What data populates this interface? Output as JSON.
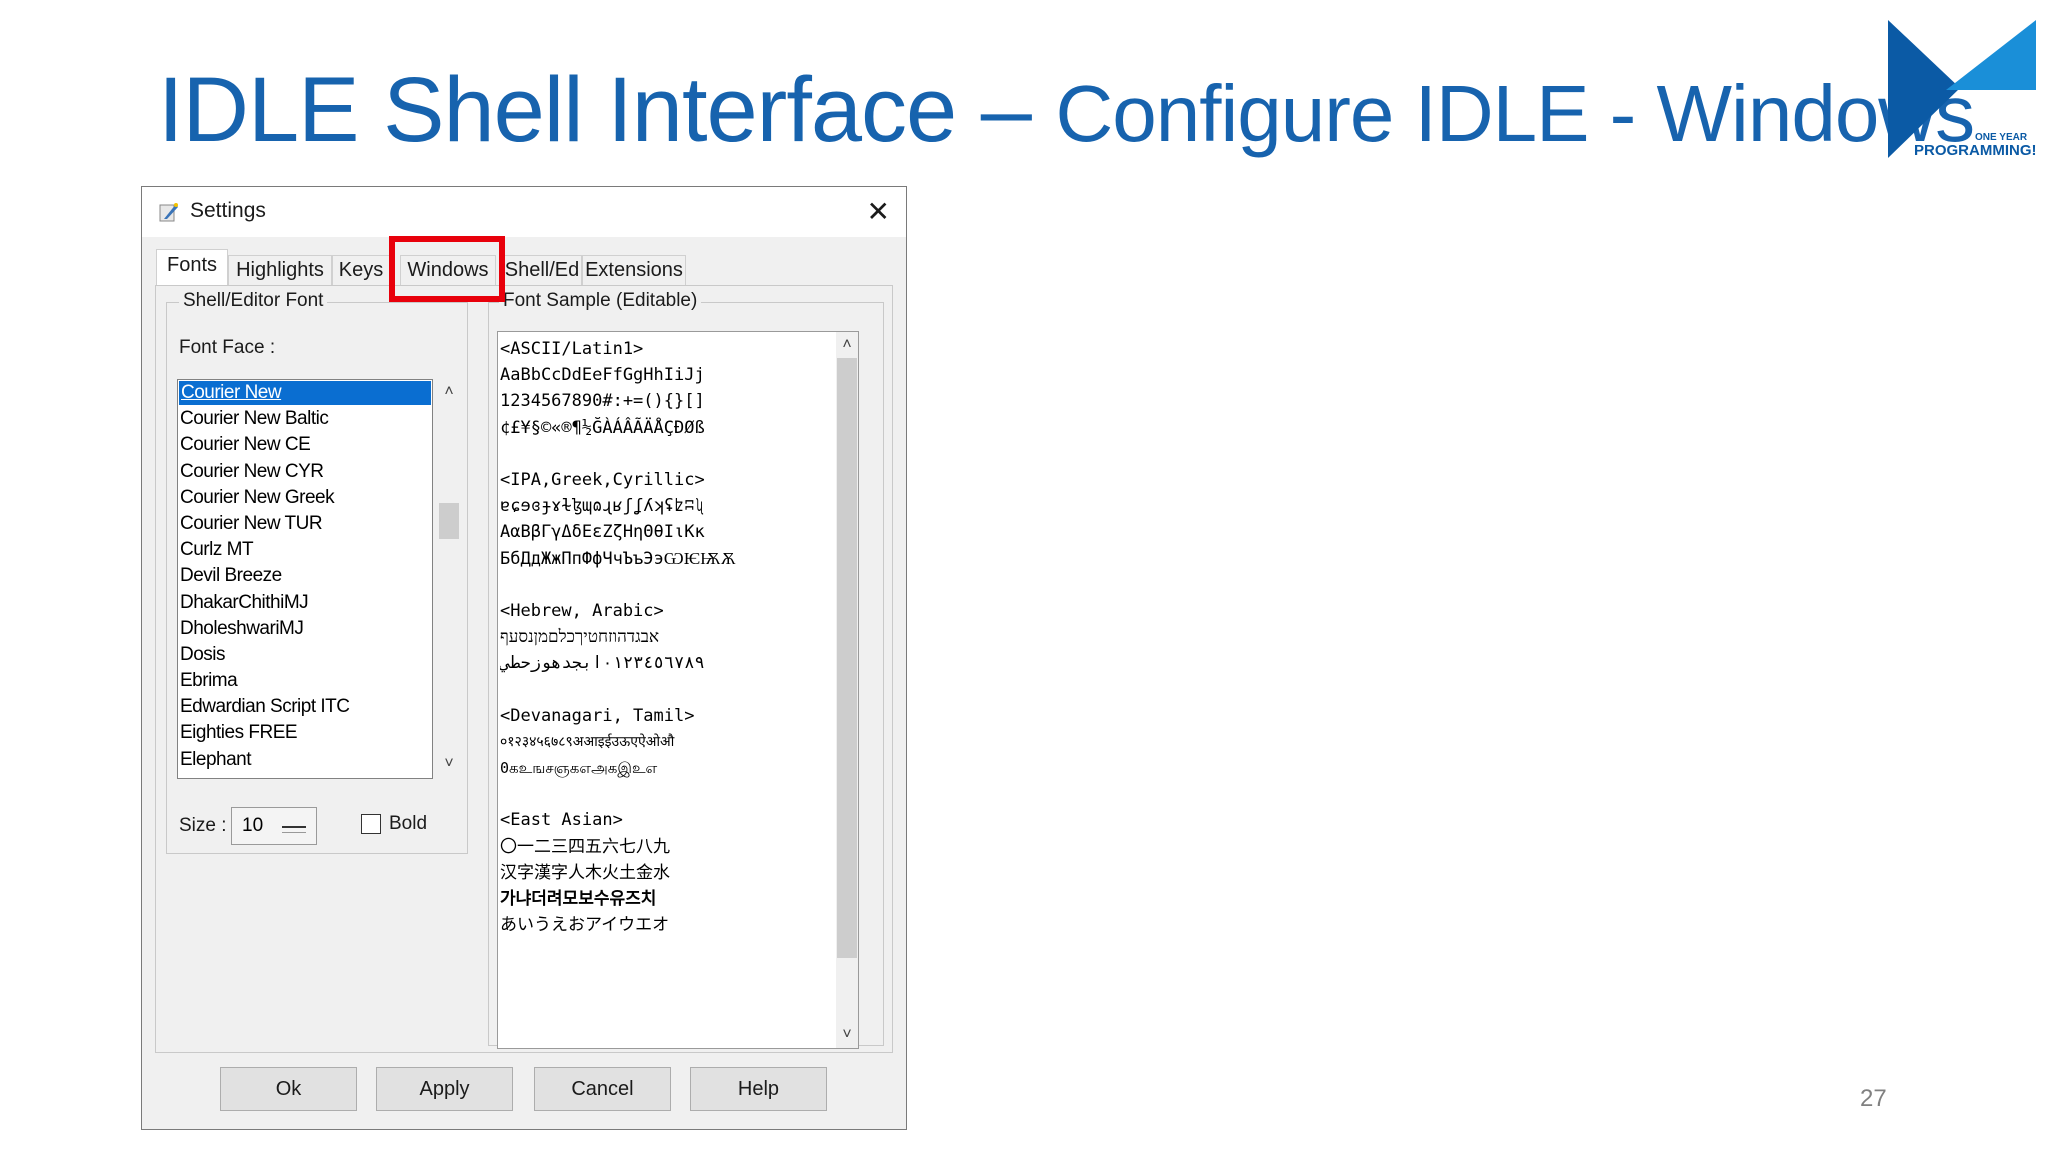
{
  "slide": {
    "title_part1": "IDLE Shell  Interface – ",
    "title_part2": "Configure IDLE - Windows",
    "page_number": "27",
    "logo": {
      "line1": "ONE YEAR",
      "line2": "PROGRAMMING",
      "mark": "!",
      "icon": "bowtie-logo-icon",
      "colors": {
        "dark": "#0b5aa5",
        "light": "#1a8fd8"
      }
    }
  },
  "window": {
    "title": "Settings",
    "icon": "python-feather-icon",
    "close_glyph": "✕",
    "tabs": [
      {
        "label": "Fonts",
        "active": true
      },
      {
        "label": "Highlights"
      },
      {
        "label": "Keys"
      },
      {
        "label": "Windows",
        "highlighted": true
      },
      {
        "label": "Shell/Ed"
      },
      {
        "label": "Extensions"
      }
    ],
    "highlight_color": "#e8000b",
    "font_group": {
      "label": "Shell/Editor Font",
      "font_face_label": "Font Face :",
      "fonts": [
        "Courier New",
        "Courier New Baltic",
        "Courier New CE",
        "Courier New CYR",
        "Courier New Greek",
        "Courier New TUR",
        "Curlz MT",
        "Devil Breeze",
        "DhakarChithiMJ",
        "DholeshwariMJ",
        "Dosis",
        "Ebrima",
        "Edwardian Script ITC",
        "Eighties FREE",
        "Elephant"
      ],
      "selected_font": "Courier New",
      "size_label": "Size :",
      "size_value": "10",
      "bold_label": "Bold",
      "bold_checked": false
    },
    "sample": {
      "label": "Font Sample (Editable)",
      "lines": [
        "<ASCII/Latin1>",
        "AaBbCcDdEeFfGgHhIiJj",
        "1234567890#:+=(){}[]",
        "¢£¥§©«®¶½ĞÀÁÂÃÄÅÇÐØß",
        "",
        "<IPA,Greek,Cyrillic>",
        "ɐɕɘɞɟɤɫɮɰɷɻʁʃʆʎʞʢʫʭʯ",
        "ΑαΒβΓγΔδΕεΖζΗηΘθΙιΚκ",
        "БбДдЖжПпФфЧчЪъЭэѠѤѬѪ",
        "",
        "<Hebrew, Arabic>",
        "אבגדהוזחטיךכלםמןנסעף",
        "٠١٢٣٤٥٦٧٨٩ابجدهوزحطي",
        "",
        "<Devanagari, Tamil>",
        "०१२३४५६७८९अआइईउऊएऐओऔ",
        "0கஉஙசஞகஎஅகஇஉஎ",
        "",
        "<East Asian>",
        "〇一二三四五六七八九",
        "汉字漢字人木火土金水",
        "가냐더려모보수유즈치",
        "あいうえおアイウエオ"
      ]
    },
    "buttons": {
      "ok": "Ok",
      "apply": "Apply",
      "cancel": "Cancel",
      "help": "Help"
    },
    "scroll_arrows": {
      "up": "˄",
      "down": "˅"
    }
  }
}
